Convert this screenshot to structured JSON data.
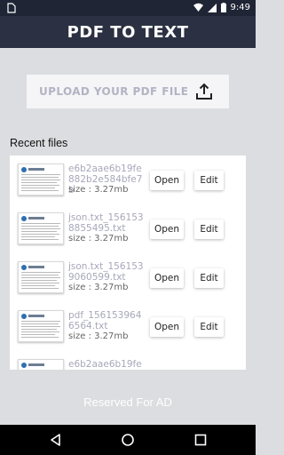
{
  "status_bar": {
    "time": "9:49"
  },
  "header": {
    "title": "PDF TO TEXT"
  },
  "upload": {
    "label": "UPLOAD YOUR PDF FILE",
    "icon": "upload-icon"
  },
  "recent": {
    "title": "Recent files",
    "files": [
      {
        "name": "e6b2aae6b19fe882b2e584bfe7b",
        "size": "size : 3.27mb",
        "open_label": "Open",
        "edit_label": "Edit"
      },
      {
        "name": "json.txt_1561538855495.txt",
        "size": "size : 3.27mb",
        "open_label": "Open",
        "edit_label": "Edit"
      },
      {
        "name": "json.txt_1561539060599.txt",
        "size": "size : 3.27mb",
        "open_label": "Open",
        "edit_label": "Edit"
      },
      {
        "name": "pdf_1561539646564.txt",
        "size": "size : 3.27mb",
        "open_label": "Open",
        "edit_label": "Edit"
      },
      {
        "name": "e6b2aae6b19fe8",
        "size": "",
        "open_label": "",
        "edit_label": ""
      }
    ]
  },
  "ad": {
    "text": "Reserved For AD"
  },
  "colors": {
    "header": "#2b3142",
    "status_bar": "#1f2535",
    "background": "#dcdde0",
    "file_name": "#a7a7ba"
  }
}
